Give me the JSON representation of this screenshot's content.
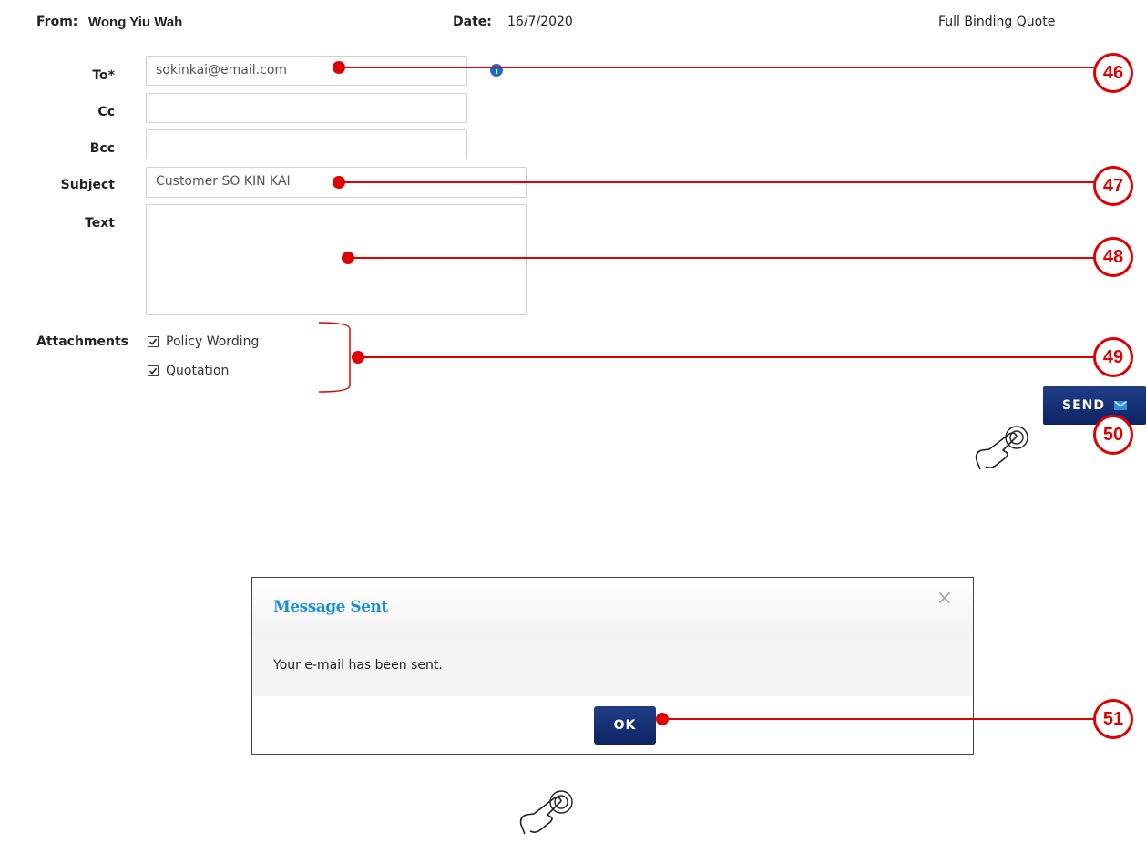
{
  "header": {
    "from_label": "From:",
    "from_value": "Wong Yiu Wah",
    "date_label": "Date:",
    "date_value": "16/7/2020",
    "quote_type": "Full Binding Quote"
  },
  "form": {
    "to_label": "To*",
    "to_value": "sokinkai@email.com",
    "cc_label": "Cc",
    "cc_value": "",
    "bcc_label": "Bcc",
    "bcc_value": "",
    "subject_label": "Subject",
    "subject_value": "Customer SO KIN KAI",
    "text_label": "Text",
    "text_value": "",
    "attachments_label": "Attachments",
    "attachments": [
      {
        "label": "Policy Wording",
        "checked": true
      },
      {
        "label": "Quotation",
        "checked": true
      }
    ],
    "send_label": "SEND"
  },
  "callouts": [
    "46",
    "47",
    "48",
    "49",
    "50",
    "51"
  ],
  "modal": {
    "title": "Message Sent",
    "close_symbol": "×",
    "message": "Your e-mail has been sent.",
    "ok_label": "OK"
  },
  "colors": {
    "accent_red": "#e00000",
    "button_navy": "#0d2464",
    "title_blue": "#1a8fd6"
  },
  "icons": [
    "info-icon",
    "envelope-icon",
    "checkbox-checked-icon",
    "tap-hand-icon",
    "close-icon"
  ]
}
